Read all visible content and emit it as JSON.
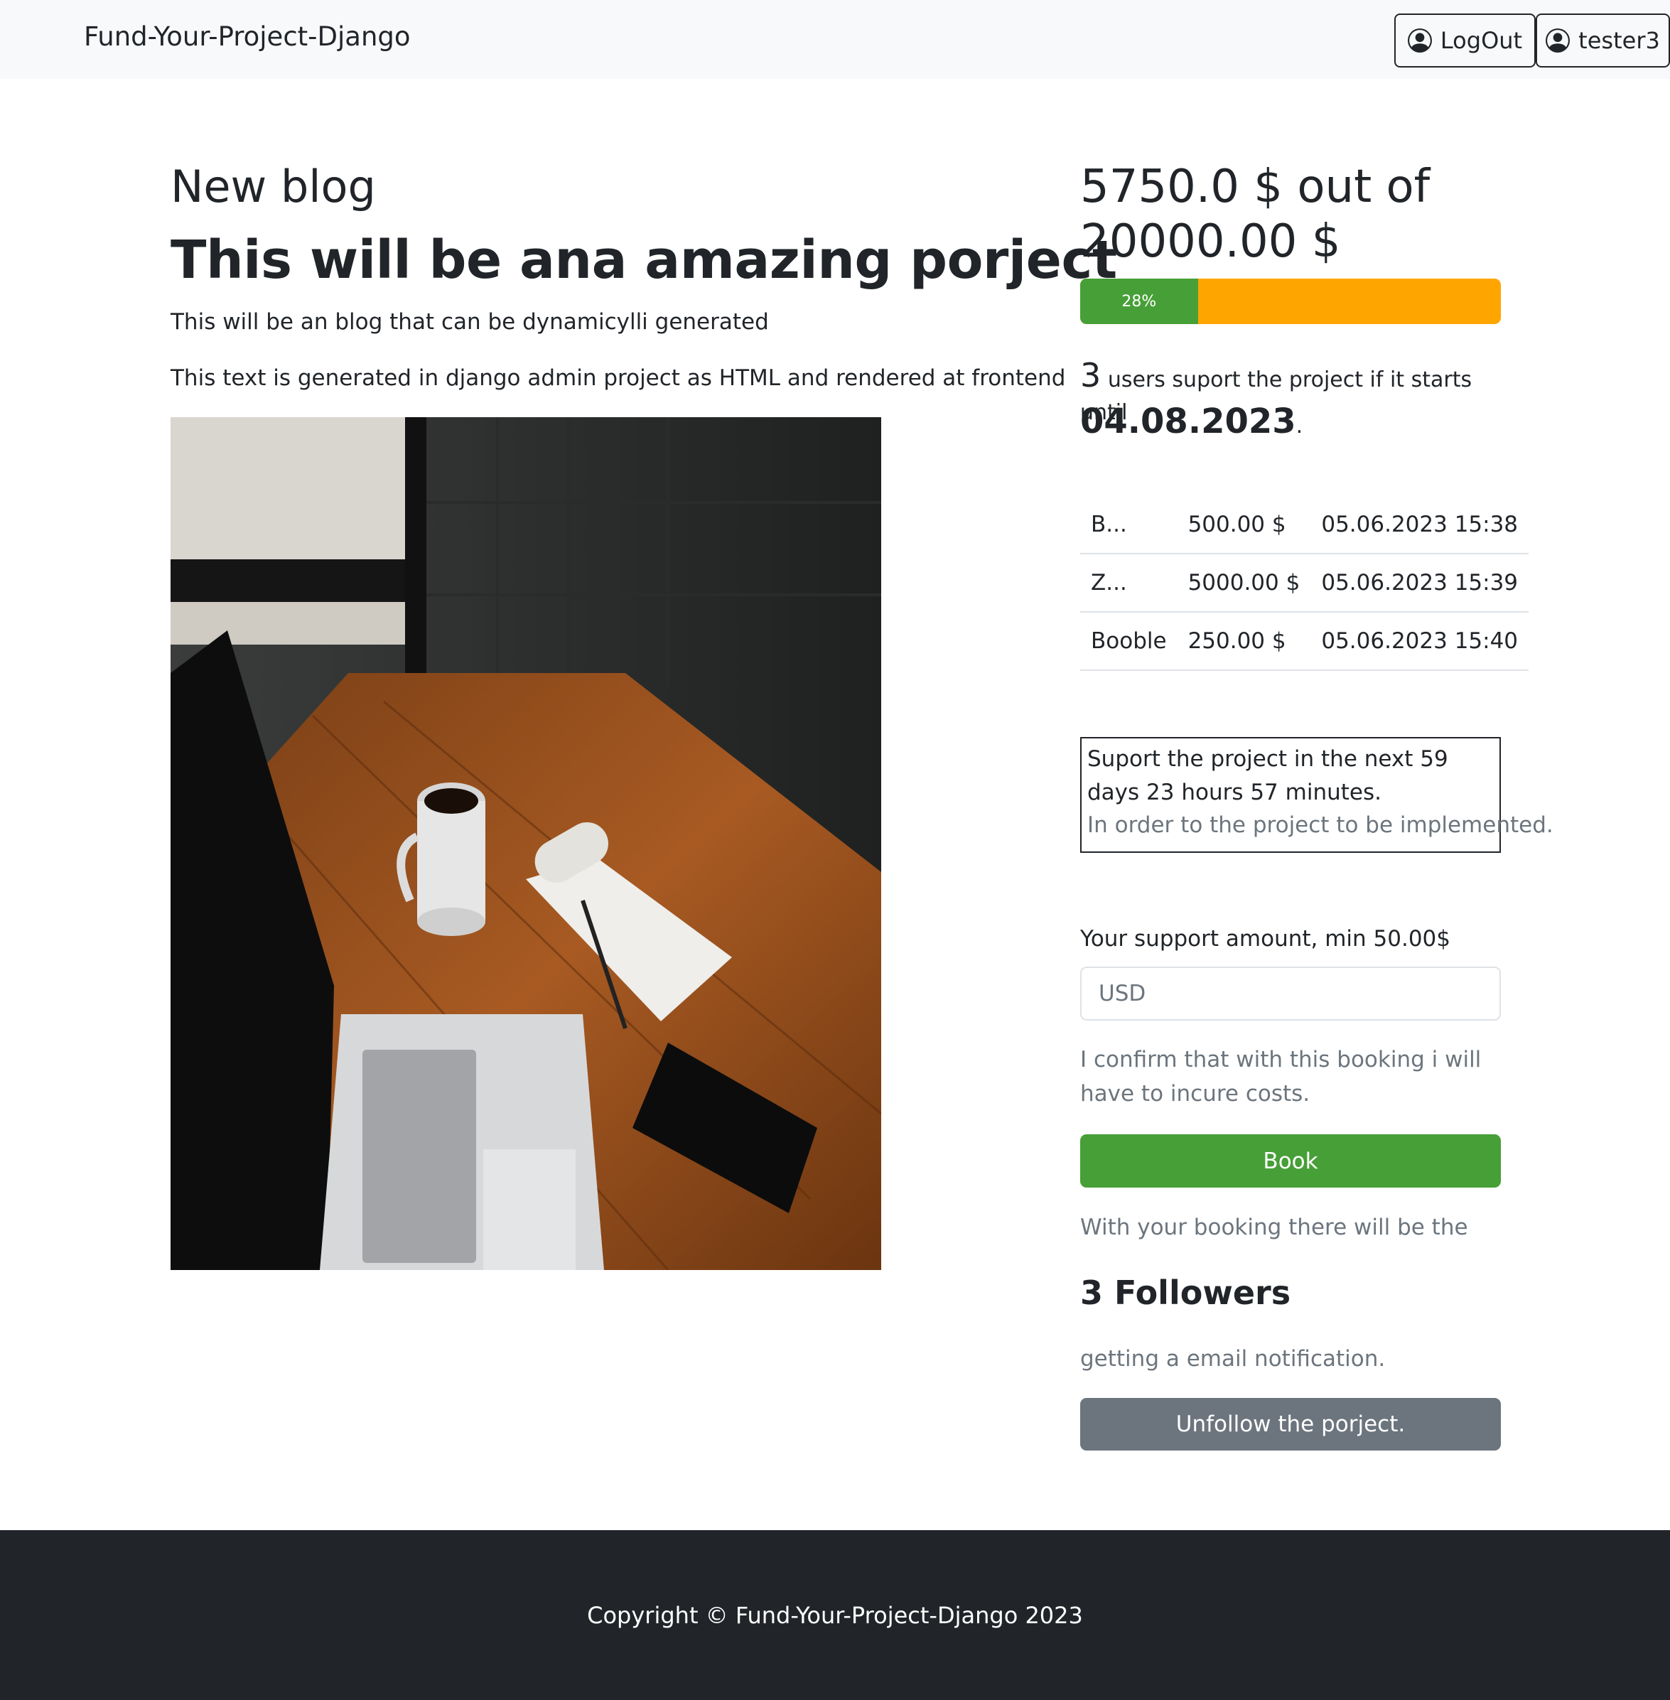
{
  "navbar": {
    "brand": "Fund-Your-Project-Django",
    "logout_label": "LogOut",
    "user_label": "tester3"
  },
  "blog": {
    "category": "New blog",
    "title": "This will be ana amazing porject",
    "subtitle": "This will be an blog that can be dynamicylli generated",
    "body": "This text is generated in django admin project as HTML and rendered at frontend"
  },
  "funding": {
    "raised_text": "5750.0 $ out of 20000.00 $",
    "progress_label": "28%",
    "progress_fraction": 0.28,
    "supporters_count": "3",
    "supporters_text": "users suport the project if it starts until",
    "deadline": "04.08.2023",
    "deadline_suffix": "."
  },
  "bookings": [
    {
      "name": "B...",
      "amount": "500.00 $",
      "date": "05.06.2023 15:38"
    },
    {
      "name": "Z...",
      "amount": "5000.00 $",
      "date": "05.06.2023 15:39"
    },
    {
      "name": "Booble",
      "amount": "250.00 $",
      "date": "05.06.2023 15:40"
    }
  ],
  "countdown": {
    "line1": "Suport the project in the next 59 days 23 hours 57 minutes.",
    "line2": "In order to the project to be implemented."
  },
  "support_form": {
    "label": "Your support amount, min 50.00$",
    "placeholder": "USD",
    "confirm_text": "I confirm that with this booking i will have to incure costs.",
    "book_label": "Book"
  },
  "followers": {
    "pre_text": "With your booking there will be the",
    "count_text": "3 Followers",
    "post_text": "getting a email notification.",
    "unfollow_label": "Unfollow the porject."
  },
  "footer": {
    "copyright": "Copyright © Fund-Your-Project-Django 2023"
  },
  "colors": {
    "progress_fill": "#479f37",
    "progress_remaining": "#ffa500",
    "book_button": "#479f37",
    "unfollow_button": "#6c757d",
    "footer_bg": "#212529",
    "navbar_bg": "#f8f9fa"
  },
  "icons": {
    "logout_icon": "person-circle-icon",
    "user_icon": "person-circle-icon"
  }
}
